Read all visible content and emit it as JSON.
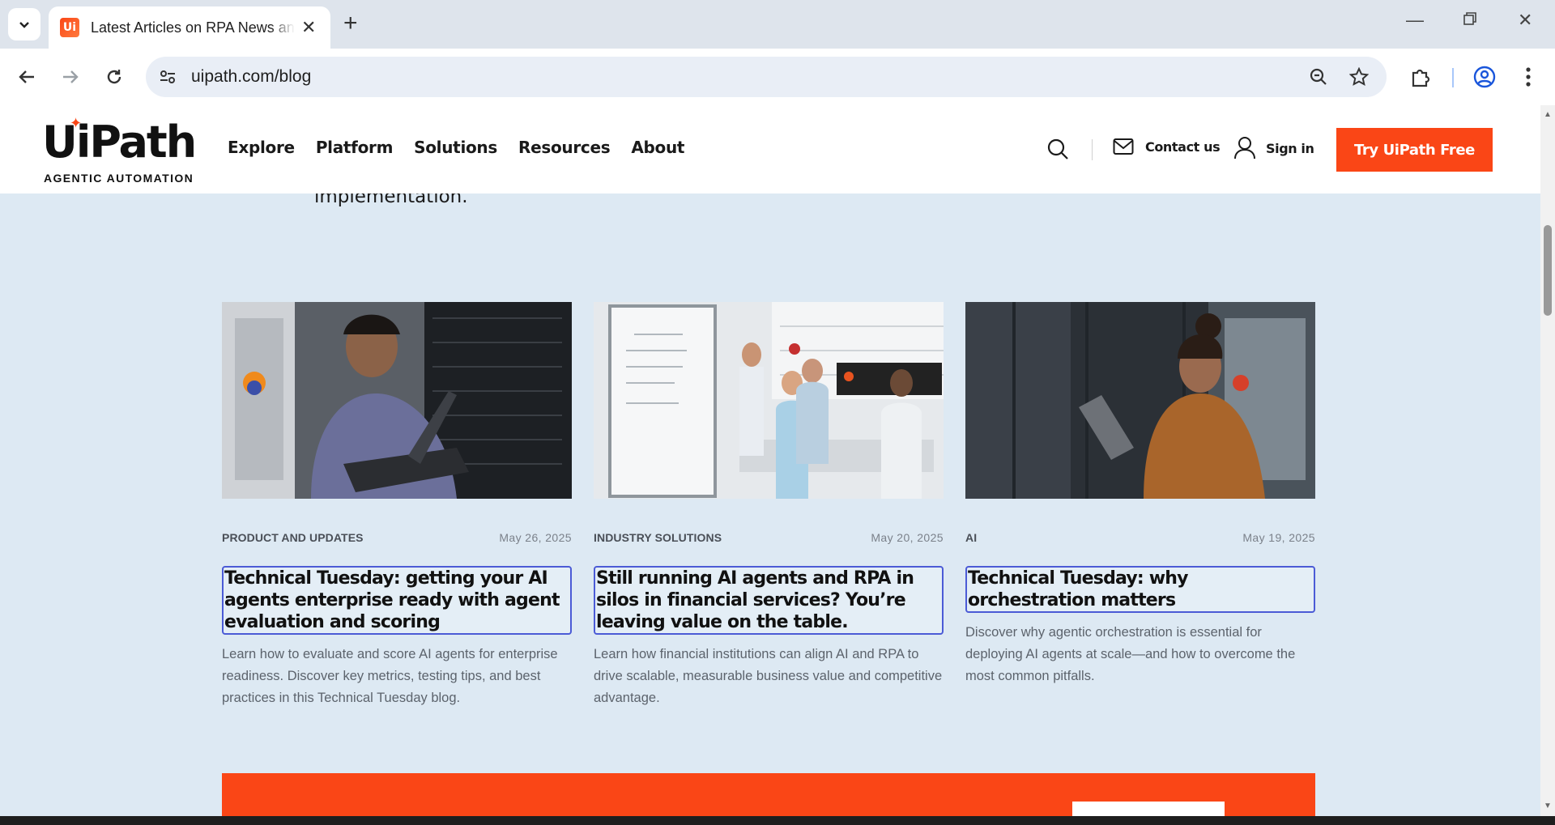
{
  "browser": {
    "tab_title": "Latest Articles on RPA News and Insights",
    "url": "uipath.com/blog",
    "favicon_text": "Ui"
  },
  "header": {
    "logo_text": "UiPath",
    "logo_tagline": "AGENTIC AUTOMATION",
    "nav": [
      "Explore",
      "Platform",
      "Solutions",
      "Resources",
      "About"
    ],
    "contact_label": "Contact us",
    "signin_label": "Sign in",
    "cta_label": "Try UiPath Free",
    "accent": "#fa4616"
  },
  "intro_fragment": "implementation.",
  "cards": [
    {
      "category": "PRODUCT AND UPDATES",
      "date": "May 26, 2025",
      "title": "Technical Tuesday: getting your AI agents enterprise ready with agent evaluation and scoring",
      "description": "Learn how to evaluate and score AI agents for enterprise readiness. Discover key metrics, testing tips, and best practices in this Technical Tuesday blog.",
      "image": "man-with-laptop-in-server-room"
    },
    {
      "category": "INDUSTRY SOLUTIONS",
      "date": "May 20, 2025",
      "title": "Still running AI agents and RPA in silos in financial services? You’re leaving value on the table.",
      "description": "Learn how financial institutions can align AI and RPA to drive scalable, measurable business value and competitive advantage.",
      "image": "team-meeting-with-whiteboard"
    },
    {
      "category": "AI",
      "date": "May 19, 2025",
      "title": "Technical Tuesday: why orchestration matters",
      "description": "Discover why agentic orchestration is essential for deploying AI agents at scale—and how to overcome the most common pitfalls.",
      "image": "woman-with-tablet-in-office"
    }
  ]
}
